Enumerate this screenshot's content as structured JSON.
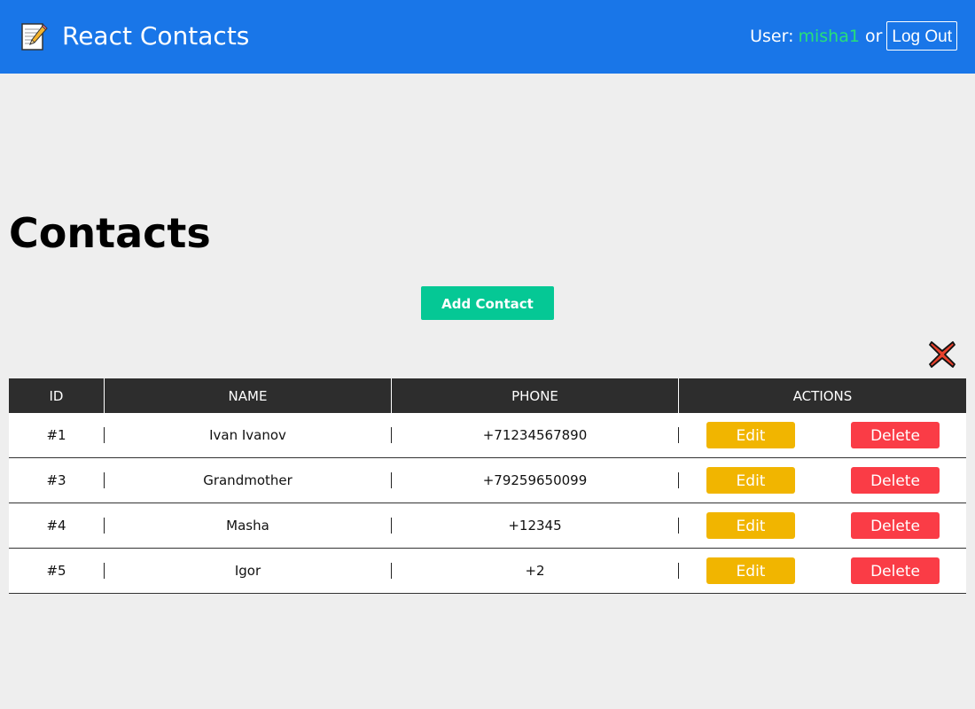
{
  "header": {
    "app_title": "React Contacts",
    "user_label": "User:",
    "username": "misha1",
    "or_text": "or",
    "logout_label": "Log Out"
  },
  "main": {
    "title": "Contacts",
    "add_button_label": "Add Contact"
  },
  "table": {
    "columns": [
      "ID",
      "NAME",
      "PHONE",
      "ACTIONS"
    ],
    "rows": [
      {
        "id": "#1",
        "name": "Ivan Ivanov",
        "phone": "+71234567890",
        "edit": "Edit",
        "delete": "Delete"
      },
      {
        "id": "#3",
        "name": "Grandmother",
        "phone": "+79259650099",
        "edit": "Edit",
        "delete": "Delete"
      },
      {
        "id": "#4",
        "name": "Masha",
        "phone": "+12345",
        "edit": "Edit",
        "delete": "Delete"
      },
      {
        "id": "#5",
        "name": "Igor",
        "phone": "+2",
        "edit": "Edit",
        "delete": "Delete"
      }
    ]
  },
  "icons": {
    "logo": "memo-icon",
    "close": "close-icon"
  },
  "colors": {
    "header_bg": "#1976e8",
    "username": "#26e07a",
    "add_button": "#05c895",
    "edit_button": "#f1b500",
    "delete_button": "#fa3c46",
    "table_header_bg": "#2d2d2d",
    "page_bg": "#eeeeee"
  }
}
